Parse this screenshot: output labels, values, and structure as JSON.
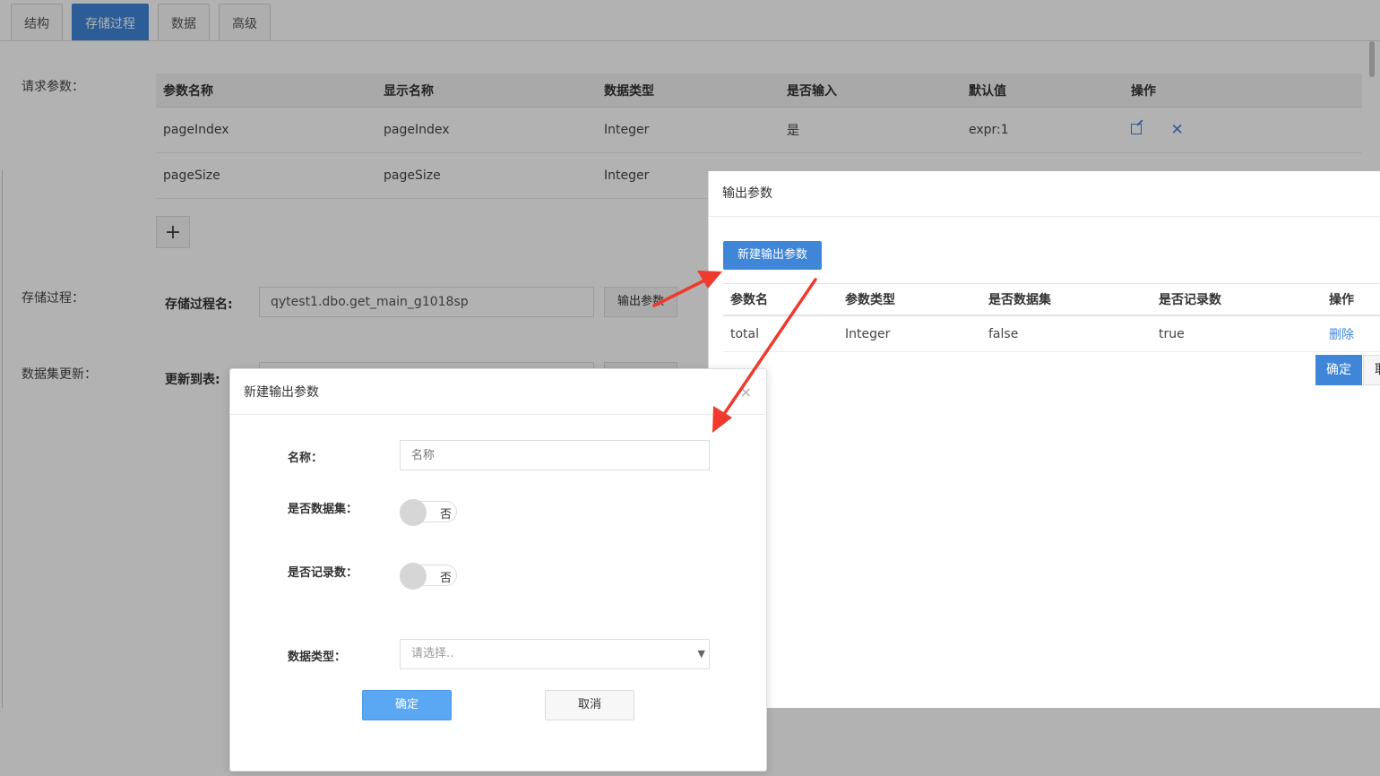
{
  "tabs": [
    "结构",
    "存储过程",
    "数据",
    "高级"
  ],
  "active_tab": 1,
  "sections": {
    "request_params": "请求参数：",
    "stored_proc": "存储过程：",
    "dataset_update": "数据集更新："
  },
  "param_table": {
    "headers": [
      "参数名称",
      "显示名称",
      "数据类型",
      "是否输入",
      "默认值",
      "操作"
    ],
    "rows": [
      [
        "pageIndex",
        "pageIndex",
        "Integer",
        "是",
        "expr:1"
      ],
      [
        "pageSize",
        "pageSize",
        "Integer",
        "",
        ""
      ]
    ],
    "add_label": "+"
  },
  "proc": {
    "label": "存储过程名:",
    "value": "qytest1.dbo.get_main_g1018sp",
    "button": "输出参数"
  },
  "update": {
    "label": "更新到表:"
  },
  "out_dialog": {
    "title": "输出参数",
    "new_button": "新建输出参数",
    "headers": [
      "参数名",
      "参数类型",
      "是否数据集",
      "是否记录数",
      "操作"
    ],
    "rows": [
      [
        "total",
        "Integer",
        "false",
        "true",
        "删除"
      ]
    ],
    "ok": "确定",
    "cancel": "取"
  },
  "new_dialog": {
    "title": "新建输出参数",
    "close": "×",
    "name_label": "名称：",
    "name_placeholder": "名称",
    "dataset_label": "是否数据集：",
    "dataset_toggle": "否",
    "record_label": "是否记录数：",
    "record_toggle": "否",
    "type_label": "数据类型：",
    "type_placeholder": "请选择..",
    "ok": "确定",
    "cancel": "取消"
  },
  "colors": {
    "accent": "#3f86d8",
    "ok_button": "#5aa7f3",
    "annotation_arrow": "#f03a2e"
  }
}
